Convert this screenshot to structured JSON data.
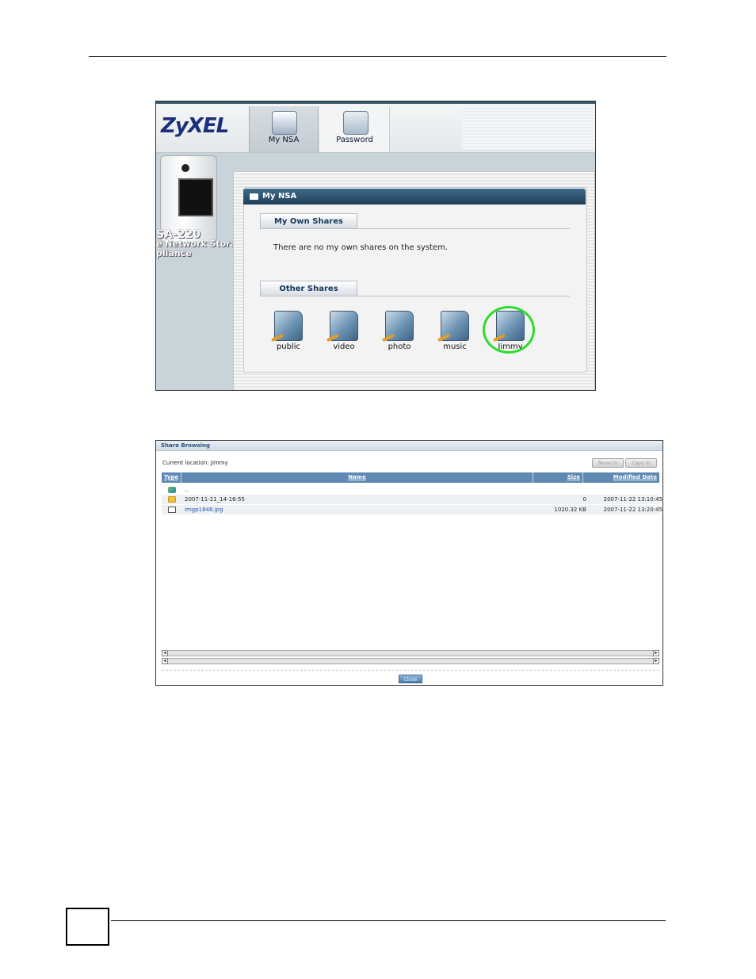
{
  "figure1": {
    "brand": "ZyXEL",
    "tabs": [
      {
        "label": "My NSA",
        "icon": "nsa-device-icon",
        "active": true
      },
      {
        "label": "Password",
        "icon": "password-card-icon",
        "active": false
      }
    ],
    "device": {
      "model": "SA-220",
      "line1": "e Network Storage",
      "line2": "pliance"
    },
    "panel_title": "My NSA",
    "my_own_shares": {
      "label": "My Own Shares",
      "message": "There are no my own shares on the system."
    },
    "other_shares": {
      "label": "Other Shares",
      "items": [
        "public",
        "video",
        "photo",
        "music",
        "Jimmy"
      ],
      "highlighted": "Jimmy",
      "highlight_color": "#2ddc2d"
    }
  },
  "figure2": {
    "title": "Share Browsing",
    "current_location": "Current location: Jimmy",
    "buttons": [
      "Move to",
      "Copy to"
    ],
    "columns": [
      "Type",
      "Name",
      "Size",
      "Modified Date"
    ],
    "rows": [
      {
        "type_icon": "up-folder-icon",
        "name": "..",
        "size": "",
        "modified": ""
      },
      {
        "type_icon": "folder-icon",
        "name": "2007-11-21_14-16-55",
        "size": "0",
        "modified": "2007-11-22 13:10:45"
      },
      {
        "type_icon": "image-file-icon",
        "name": "imgp1848.jpg",
        "size": "1020.32 KB",
        "modified": "2007-11-22 13:20:45"
      }
    ],
    "close_label": "Close"
  }
}
